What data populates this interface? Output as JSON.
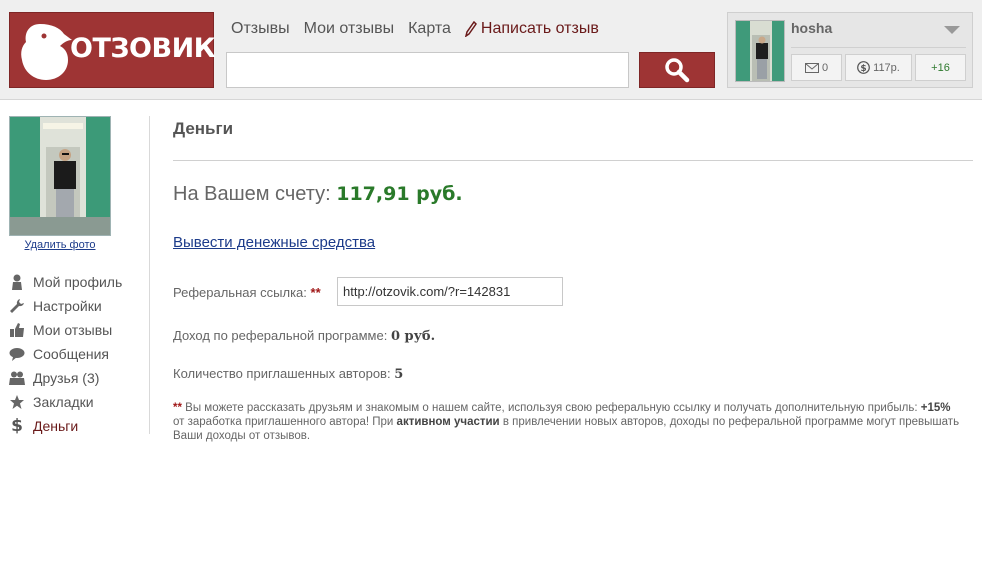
{
  "header": {
    "logo_text": "ОТЗОВИК",
    "nav": {
      "reviews": "Отзывы",
      "my_reviews": "Мои отзывы",
      "map": "Карта",
      "write_review": "Написать отзыв"
    },
    "search": {
      "value": "",
      "placeholder": ""
    }
  },
  "user": {
    "name": "hosha",
    "messages": "0",
    "money": "117р.",
    "rating": "+16"
  },
  "sidebar": {
    "delete_photo": "Удалить фото",
    "items": [
      {
        "label": "Мой профиль",
        "icon": "person-icon"
      },
      {
        "label": "Настройки",
        "icon": "wrench-icon"
      },
      {
        "label": "Мои отзывы",
        "icon": "thumbs-up-icon"
      },
      {
        "label": "Сообщения",
        "icon": "speech-bubble-icon"
      },
      {
        "label": "Друзья (3)",
        "icon": "people-icon"
      },
      {
        "label": "Закладки",
        "icon": "star-icon"
      },
      {
        "label": "Деньги",
        "icon": "dollar-icon"
      }
    ]
  },
  "main": {
    "title": "Деньги",
    "balance_label": "На Вашем счету:",
    "balance_amount": "117,91 руб.",
    "withdraw_link": "Вывести денежные средства",
    "ref_label": "Реферальная ссылка:",
    "required_mark": "**",
    "ref_link": "http://otzovik.com/?r=142831",
    "income_label": "Доход по реферальной программе:",
    "income_value": "0 руб.",
    "invited_label": "Количество приглашенных авторов:",
    "invited_value": "5",
    "note": {
      "part1": "Вы можете рассказать друзьям и знакомым о нашем сайте, используя свою реферальную ссылку и получать дополнительную прибыль:",
      "percent": "+15%",
      "part2": "от заработка приглашенного автора! При",
      "active": "активном участии",
      "part3": "в привлечении новых авторов, доходы по реферальной программе могут превышать Ваши доходы от отзывов."
    }
  },
  "colors": {
    "brand": "#9e3434",
    "balance_green": "#2a7a2a",
    "link_blue": "#1c3b8a",
    "active_menu": "#6a1a1a"
  }
}
